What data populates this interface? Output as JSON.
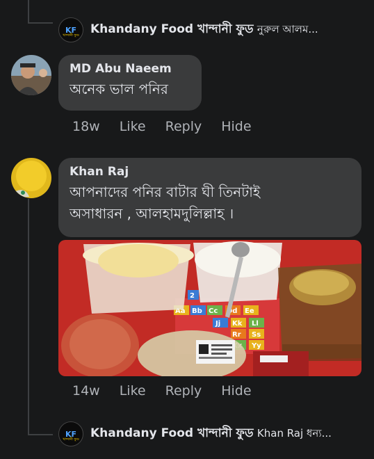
{
  "reply_top": {
    "page_name": "Khandany Food খান্দানী ফুড",
    "snippet": "নুরুল আলম..."
  },
  "comment1": {
    "author": "MD Abu Naeem",
    "text": "অনেক ভাল পনির",
    "time": "18w",
    "like": "Like",
    "reply": "Reply",
    "hide": "Hide"
  },
  "comment2": {
    "author": "Khan Raj",
    "text_line1": "আপনাদের পনির বাটার ঘী তিনটাই",
    "text_line2": "অসাধারন , আলহামদুলিল্লাহ ।",
    "time": "14w",
    "like": "Like",
    "reply": "Reply",
    "hide": "Hide",
    "photo_mat_letters": [
      "2",
      "Aa",
      "Bb",
      "Cc",
      "Dd",
      "Ee",
      "Jj",
      "Kk",
      "Ll",
      "Rr",
      "Ss",
      "Xx",
      "Yy"
    ]
  },
  "reply_bottom": {
    "page_name": "Khandany Food খান্দানী ফুড",
    "snippet": "Khan Raj ধন্য..."
  },
  "page_avatar": {
    "logo": "KF",
    "caption": "খান্দানী ফুড"
  },
  "colors": {
    "background": "#18191a",
    "bubble": "#3a3b3c",
    "action_text": "#b0b3b8",
    "thread_line": "#3e4042"
  }
}
